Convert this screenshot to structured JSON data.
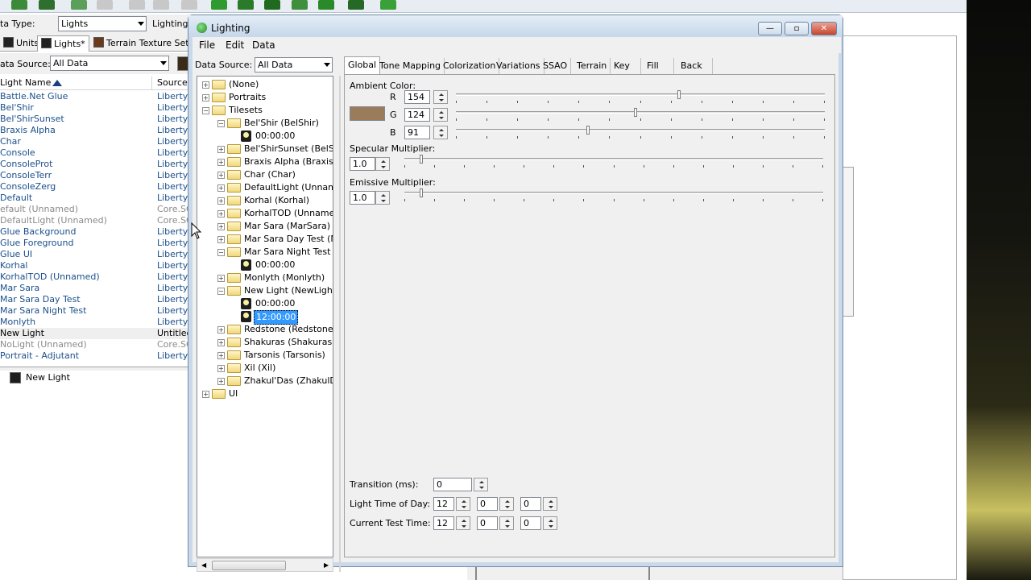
{
  "editor": {
    "data_type_label": "ta Type:",
    "data_type_value": "Lights",
    "lighting_label": "Lighting",
    "tabs": [
      {
        "label": "Units",
        "selected": false
      },
      {
        "label": "Lights*",
        "selected": true
      },
      {
        "label": "Terrain Texture Sets",
        "selected": false
      }
    ],
    "data_source_label": "ata Source:",
    "data_source_value": "All Data",
    "columns": {
      "name": "Light Name",
      "source": "Source"
    },
    "lights": [
      {
        "name": "Battle.Net Glue",
        "source": "Liberty.S",
        "core": false
      },
      {
        "name": "Bel'Shir",
        "source": "Liberty.S",
        "core": false
      },
      {
        "name": "Bel'ShirSunset",
        "source": "Liberty.S",
        "core": false
      },
      {
        "name": "Braxis Alpha",
        "source": "Liberty.S",
        "core": false
      },
      {
        "name": "Char",
        "source": "Liberty.S",
        "core": false
      },
      {
        "name": "Console",
        "source": "Liberty.S",
        "core": false
      },
      {
        "name": "ConsoleProt",
        "source": "Liberty.S",
        "core": false
      },
      {
        "name": "ConsoleTerr",
        "source": "Liberty.S",
        "core": false
      },
      {
        "name": "ConsoleZerg",
        "source": "Liberty.S",
        "core": false
      },
      {
        "name": "Default",
        "source": "Liberty.S",
        "core": false
      },
      {
        "name": "efault (Unnamed)",
        "source": "Core.SC",
        "core": true
      },
      {
        "name": "DefaultLight (Unnamed)",
        "source": "Core.SC",
        "core": true
      },
      {
        "name": "Glue Background",
        "source": "Liberty.S",
        "core": false
      },
      {
        "name": "Glue Foreground",
        "source": "Liberty.S",
        "core": false
      },
      {
        "name": "Glue UI",
        "source": "Liberty.S",
        "core": false
      },
      {
        "name": "Korhal",
        "source": "Liberty.S",
        "core": false
      },
      {
        "name": "KorhalTOD (Unnamed)",
        "source": "Liberty.S",
        "core": false
      },
      {
        "name": "Mar Sara",
        "source": "Liberty.S",
        "core": false
      },
      {
        "name": "Mar Sara Day Test",
        "source": "Liberty.S",
        "core": false
      },
      {
        "name": "Mar Sara Night Test",
        "source": "Liberty.S",
        "core": false
      },
      {
        "name": "Monlyth",
        "source": "Liberty.S",
        "core": false
      },
      {
        "name": "New Light",
        "source": "Untitled",
        "core": false,
        "selected": true
      },
      {
        "name": "NoLight (Unnamed)",
        "source": "Core.SC",
        "core": true
      },
      {
        "name": "Portrait - Adjutant",
        "source": "Liberty.S",
        "core": false
      }
    ],
    "lower_panel_item": "New Light"
  },
  "dialog": {
    "title": "Lighting",
    "menus": [
      "File",
      "Edit",
      "Data"
    ],
    "data_source_label": "Data Source:",
    "data_source_value": "All Data",
    "tree": [
      {
        "label": "(None)",
        "level": 0,
        "expander": "+",
        "kind": "folder"
      },
      {
        "label": "Portraits",
        "level": 0,
        "expander": "+",
        "kind": "folder"
      },
      {
        "label": "Tilesets",
        "level": 0,
        "expander": "-",
        "kind": "open-folder"
      },
      {
        "label": "Bel'Shir (BelShir)",
        "level": 1,
        "expander": "-",
        "kind": "open-folder"
      },
      {
        "label": "00:00:00",
        "level": 2,
        "expander": "",
        "kind": "light"
      },
      {
        "label": "Bel'ShirSunset (BelShir",
        "level": 1,
        "expander": "+",
        "kind": "folder"
      },
      {
        "label": "Braxis Alpha (BraxisAlp",
        "level": 1,
        "expander": "+",
        "kind": "folder"
      },
      {
        "label": "Char (Char)",
        "level": 1,
        "expander": "+",
        "kind": "folder"
      },
      {
        "label": "DefaultLight (Unnamed",
        "level": 1,
        "expander": "+",
        "kind": "folder"
      },
      {
        "label": "Korhal (Korhal)",
        "level": 1,
        "expander": "+",
        "kind": "folder"
      },
      {
        "label": "KorhalTOD (Unnamed)",
        "level": 1,
        "expander": "+",
        "kind": "folder"
      },
      {
        "label": "Mar Sara (MarSara)",
        "level": 1,
        "expander": "+",
        "kind": "folder"
      },
      {
        "label": "Mar Sara Day Test (Ma",
        "level": 1,
        "expander": "+",
        "kind": "folder"
      },
      {
        "label": "Mar Sara Night Test (M",
        "level": 1,
        "expander": "-",
        "kind": "open-folder"
      },
      {
        "label": "00:00:00",
        "level": 2,
        "expander": "",
        "kind": "light"
      },
      {
        "label": "Monlyth (Monlyth)",
        "level": 1,
        "expander": "+",
        "kind": "folder"
      },
      {
        "label": "New Light (NewLight)",
        "level": 1,
        "expander": "-",
        "kind": "open-folder"
      },
      {
        "label": "00:00:00",
        "level": 2,
        "expander": "",
        "kind": "light"
      },
      {
        "label": "12:00:00",
        "level": 2,
        "expander": "",
        "kind": "light",
        "selected": true
      },
      {
        "label": "Redstone (Redstone)",
        "level": 1,
        "expander": "+",
        "kind": "folder"
      },
      {
        "label": "Shakuras (Shakuras)",
        "level": 1,
        "expander": "+",
        "kind": "folder"
      },
      {
        "label": "Tarsonis (Tarsonis)",
        "level": 1,
        "expander": "+",
        "kind": "folder"
      },
      {
        "label": "Xil (Xil)",
        "level": 1,
        "expander": "+",
        "kind": "folder"
      },
      {
        "label": "Zhakul'Das (ZhakulDa",
        "level": 1,
        "expander": "+",
        "kind": "folder"
      },
      {
        "label": "UI",
        "level": 0,
        "expander": "+",
        "kind": "folder"
      }
    ],
    "tabs": [
      "Global",
      "Tone Mapping",
      "Colorization",
      "Variations",
      "SSAO",
      "Terrain",
      "Key",
      "Fill",
      "Back"
    ],
    "selected_tab": "Global",
    "global": {
      "ambient_color_label": "Ambient Color:",
      "ambient_swatch_color": "#9a7c5b",
      "channels": [
        {
          "label": "R",
          "value": "154",
          "fraction": 0.604
        },
        {
          "label": "G",
          "value": "124",
          "fraction": 0.486
        },
        {
          "label": "B",
          "value": "91",
          "fraction": 0.357
        }
      ],
      "specular_label": "Specular Multiplier:",
      "specular_value": "1.0",
      "specular_fraction": 0.04,
      "emissive_label": "Emissive Multiplier:",
      "emissive_value": "1.0",
      "emissive_fraction": 0.04,
      "transition_label": "Transition (ms):",
      "transition_value": "0",
      "light_time_label": "Light Time of Day:",
      "light_time": [
        "12",
        "0",
        "0"
      ],
      "test_time_label": "Current Test Time:",
      "test_time": [
        "12",
        "0",
        "0"
      ]
    }
  }
}
